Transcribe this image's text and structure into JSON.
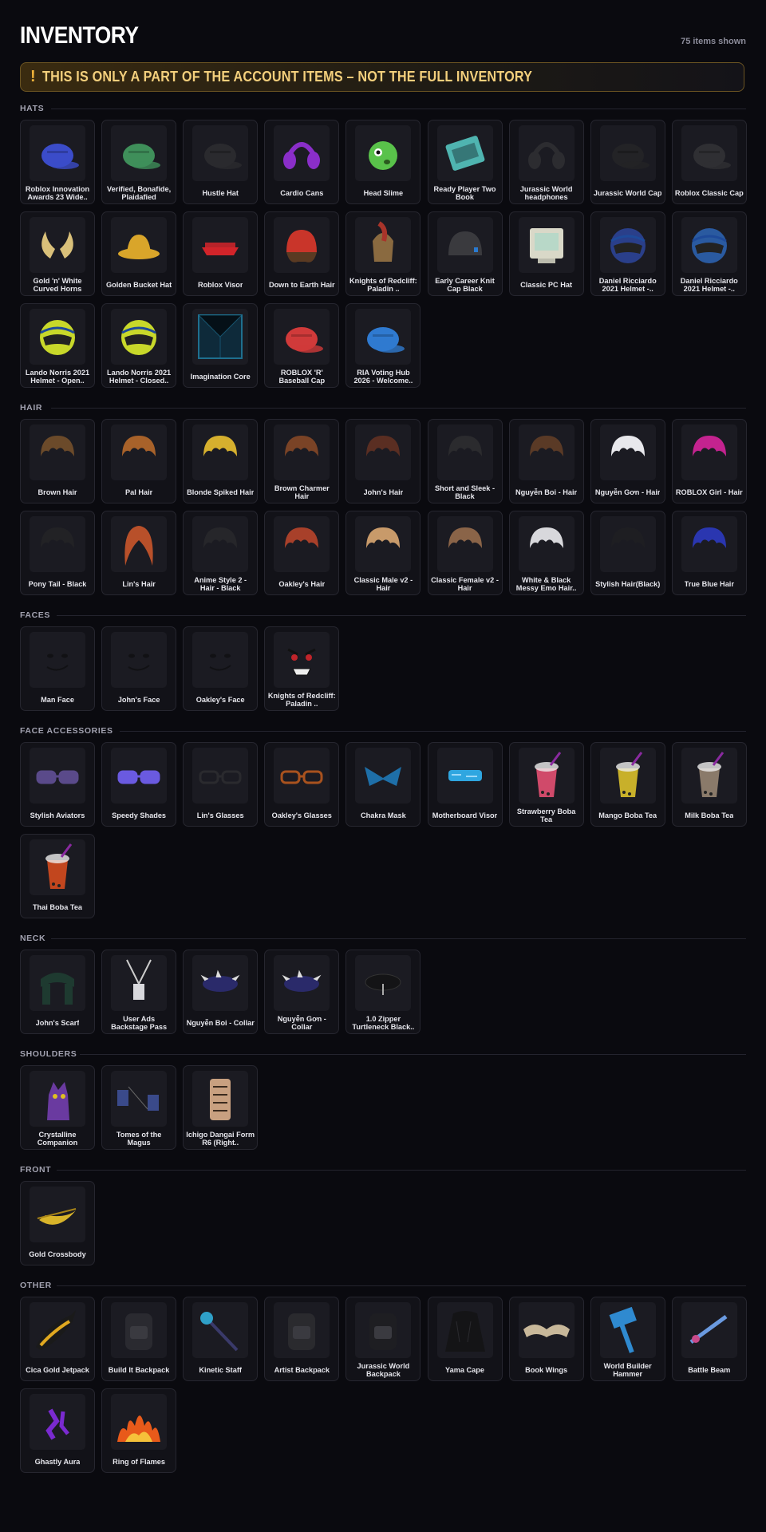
{
  "header": {
    "title": "INVENTORY",
    "count": "75 items shown",
    "banner_icon": "!",
    "banner_text": "THIS IS ONLY A PART OF THE ACCOUNT ITEMS – NOT THE FULL INVENTORY"
  },
  "colors": {
    "background": "#0a0a0f",
    "card": "#121218",
    "banner_text": "#f3cf7c",
    "banner_border": "#6b5422"
  },
  "sections": [
    {
      "label": "HATS",
      "items": [
        {
          "name": "Roblox Innovation Awards 23 Wide..",
          "icon": "blue-cap",
          "color": "#3b4cc9"
        },
        {
          "name": "Verified, Bonafide, Plaidafied",
          "icon": "green-plaid-cap",
          "color": "#3f8f5a"
        },
        {
          "name": "Hustle Hat",
          "icon": "black-cap",
          "color": "#2a2a2e"
        },
        {
          "name": "Cardio Cans",
          "icon": "purple-headphones",
          "color": "#8a2ec9"
        },
        {
          "name": "Head Slime",
          "icon": "green-slime",
          "color": "#59c24a"
        },
        {
          "name": "Ready Player Two Book",
          "icon": "teal-book",
          "color": "#4fb4b0"
        },
        {
          "name": "Jurassic World headphones",
          "icon": "black-headphones",
          "color": "#2c2c30"
        },
        {
          "name": "Jurassic World Cap",
          "icon": "black-cap",
          "color": "#232326"
        },
        {
          "name": "Roblox Classic Cap",
          "icon": "black-cap",
          "color": "#2f2f33"
        },
        {
          "name": "Gold 'n' White Curved Horns",
          "icon": "horns",
          "color": "#d9c07a"
        },
        {
          "name": "Golden Bucket Hat",
          "icon": "bucket-hat",
          "color": "#d9a52a"
        },
        {
          "name": "Roblox Visor",
          "icon": "red-visor",
          "color": "#d2242a"
        },
        {
          "name": "Down to Earth Hair",
          "icon": "red-beanie-hair",
          "color": "#c9352a"
        },
        {
          "name": "Knights of Redcliff: Paladin ..",
          "icon": "knight-helmet",
          "color": "#a8342a"
        },
        {
          "name": "Early Career Knit Cap Black",
          "icon": "knit-cap",
          "color": "#3a3a3e"
        },
        {
          "name": "Classic PC Hat",
          "icon": "pc-monitor",
          "color": "#d9d8c8"
        },
        {
          "name": "Daniel Ricciardo 2021 Helmet -..",
          "icon": "race-helmet",
          "color": "#2a3f8a"
        },
        {
          "name": "Daniel Ricciardo 2021 Helmet -..",
          "icon": "race-helmet",
          "color": "#2a5aa0"
        },
        {
          "name": "Lando Norris 2021 Helmet - Open..",
          "icon": "race-helmet",
          "color": "#c8d82a"
        },
        {
          "name": "Lando Norris 2021 Helmet - Closed..",
          "icon": "race-helmet",
          "color": "#c8d82a"
        },
        {
          "name": "Imagination Core",
          "icon": "cube",
          "color": "#1e6f8f"
        },
        {
          "name": "ROBLOX 'R' Baseball Cap",
          "icon": "red-cap",
          "color": "#d03a3a"
        },
        {
          "name": "RIA Voting Hub 2026 - Welcome..",
          "icon": "blue-cap",
          "color": "#2f7ad0"
        }
      ]
    },
    {
      "label": "HAIR",
      "items": [
        {
          "name": "Brown Hair",
          "icon": "hair",
          "color": "#6b4a2a"
        },
        {
          "name": "Pal Hair",
          "icon": "hair",
          "color": "#a8622a"
        },
        {
          "name": "Blonde Spiked Hair",
          "icon": "hair",
          "color": "#d6b02e"
        },
        {
          "name": "Brown Charmer Hair",
          "icon": "hair",
          "color": "#7a4326"
        },
        {
          "name": "John's Hair",
          "icon": "hair",
          "color": "#5a2e22"
        },
        {
          "name": "Short and Sleek - Black",
          "icon": "hair",
          "color": "#2b2b2e"
        },
        {
          "name": "Nguyễn Boi - Hair",
          "icon": "hair",
          "color": "#5a3a26"
        },
        {
          "name": "Nguyễn Gơn - Hair",
          "icon": "hair",
          "color": "#e8e8ec"
        },
        {
          "name": "ROBLOX Girl - Hair",
          "icon": "hair",
          "color": "#c4238f"
        },
        {
          "name": "Pony Tail - Black",
          "icon": "hair",
          "color": "#222225"
        },
        {
          "name": "Lin's Hair",
          "icon": "long-hair",
          "color": "#b8502a"
        },
        {
          "name": "Anime Style 2 - Hair - Black",
          "icon": "hair",
          "color": "#26262a"
        },
        {
          "name": "Oakley's Hair",
          "icon": "hair",
          "color": "#a8402a"
        },
        {
          "name": "Classic Male v2 - Hair",
          "icon": "hair",
          "color": "#c89a6a"
        },
        {
          "name": "Classic Female v2 - Hair",
          "icon": "hair",
          "color": "#8a6448"
        },
        {
          "name": "White & Black Messy Emo Hair..",
          "icon": "hair",
          "color": "#d8d8dc"
        },
        {
          "name": "Stylish Hair(Black)",
          "icon": "hair",
          "color": "#1e1e22"
        },
        {
          "name": "True Blue Hair",
          "icon": "hair",
          "color": "#2a36b0"
        }
      ]
    },
    {
      "label": "FACES",
      "items": [
        {
          "name": "Man Face",
          "icon": "face",
          "color": "#111114"
        },
        {
          "name": "John's Face",
          "icon": "face",
          "color": "#111114"
        },
        {
          "name": "Oakley's Face",
          "icon": "face",
          "color": "#111114"
        },
        {
          "name": "Knights of Redcliff: Paladin ..",
          "icon": "angry-face",
          "color": "#c0242a"
        }
      ]
    },
    {
      "label": "FACE ACCESSORIES",
      "items": [
        {
          "name": "Stylish Aviators",
          "icon": "sunglasses",
          "color": "#5a4a8a"
        },
        {
          "name": "Speedy Shades",
          "icon": "shutter-shades",
          "color": "#6a5ae0"
        },
        {
          "name": "Lin's Glasses",
          "icon": "glasses",
          "color": "#2a2a2e"
        },
        {
          "name": "Oakley's Glasses",
          "icon": "glasses",
          "color": "#a8521e"
        },
        {
          "name": "Chakra Mask",
          "icon": "mask",
          "color": "#1e6fa8"
        },
        {
          "name": "Motherboard Visor",
          "icon": "visor",
          "color": "#2fa6e0"
        },
        {
          "name": "Strawberry Boba Tea",
          "icon": "boba",
          "color": "#d04a6a"
        },
        {
          "name": "Mango Boba Tea",
          "icon": "boba",
          "color": "#c8b02a"
        },
        {
          "name": "Milk Boba Tea",
          "icon": "boba",
          "color": "#8a7a6a"
        },
        {
          "name": "Thai Boba Tea",
          "icon": "boba",
          "color": "#c2461e"
        }
      ]
    },
    {
      "label": "NECK",
      "items": [
        {
          "name": "John's Scarf",
          "icon": "scarf",
          "color": "#1e3a30"
        },
        {
          "name": "User Ads Backstage Pass",
          "icon": "lanyard",
          "color": "#d8d8dc"
        },
        {
          "name": "Nguyễn Boi - Collar",
          "icon": "spiked-collar",
          "color": "#2a2a6a"
        },
        {
          "name": "Nguyễn Gơn - Collar",
          "icon": "spiked-collar",
          "color": "#2a2a6a"
        },
        {
          "name": "1.0 Zipper Turtleneck Black..",
          "icon": "turtleneck",
          "color": "#141416"
        }
      ]
    },
    {
      "label": "SHOULDERS",
      "items": [
        {
          "name": "Crystalline Companion",
          "icon": "creature",
          "color": "#6a3aa0"
        },
        {
          "name": "Tomes of the Magus",
          "icon": "tomes",
          "color": "#3a4a8a"
        },
        {
          "name": "Ichigo Dangai Form R6 (Right..",
          "icon": "chain",
          "color": "#c8a080"
        }
      ]
    },
    {
      "label": "FRONT",
      "items": [
        {
          "name": "Gold Crossbody",
          "icon": "gold-bag",
          "color": "#d8b42a"
        }
      ]
    },
    {
      "label": "OTHER",
      "items": [
        {
          "name": "Cica Gold Jetpack",
          "icon": "jetpack",
          "color": "#e0a820"
        },
        {
          "name": "Build It Backpack",
          "icon": "backpack",
          "color": "#2a2a30"
        },
        {
          "name": "Kinetic Staff",
          "icon": "staff",
          "color": "#2fa0c8"
        },
        {
          "name": "Artist Backpack",
          "icon": "backpack",
          "color": "#2a2a2e"
        },
        {
          "name": "Jurassic World Backpack",
          "icon": "backpack",
          "color": "#1e1e22"
        },
        {
          "name": "Yama Cape",
          "icon": "cape",
          "color": "#141416"
        },
        {
          "name": "Book Wings",
          "icon": "wings",
          "color": "#c8b89a"
        },
        {
          "name": "World Builder Hammer",
          "icon": "hammer",
          "color": "#2f8ad0"
        },
        {
          "name": "Battle Beam",
          "icon": "beam",
          "color": "#6a9ae0"
        },
        {
          "name": "Ghastly Aura",
          "icon": "aura",
          "color": "#7a2ad0"
        },
        {
          "name": "Ring of Flames",
          "icon": "flames",
          "color": "#e85a1a"
        }
      ]
    }
  ]
}
